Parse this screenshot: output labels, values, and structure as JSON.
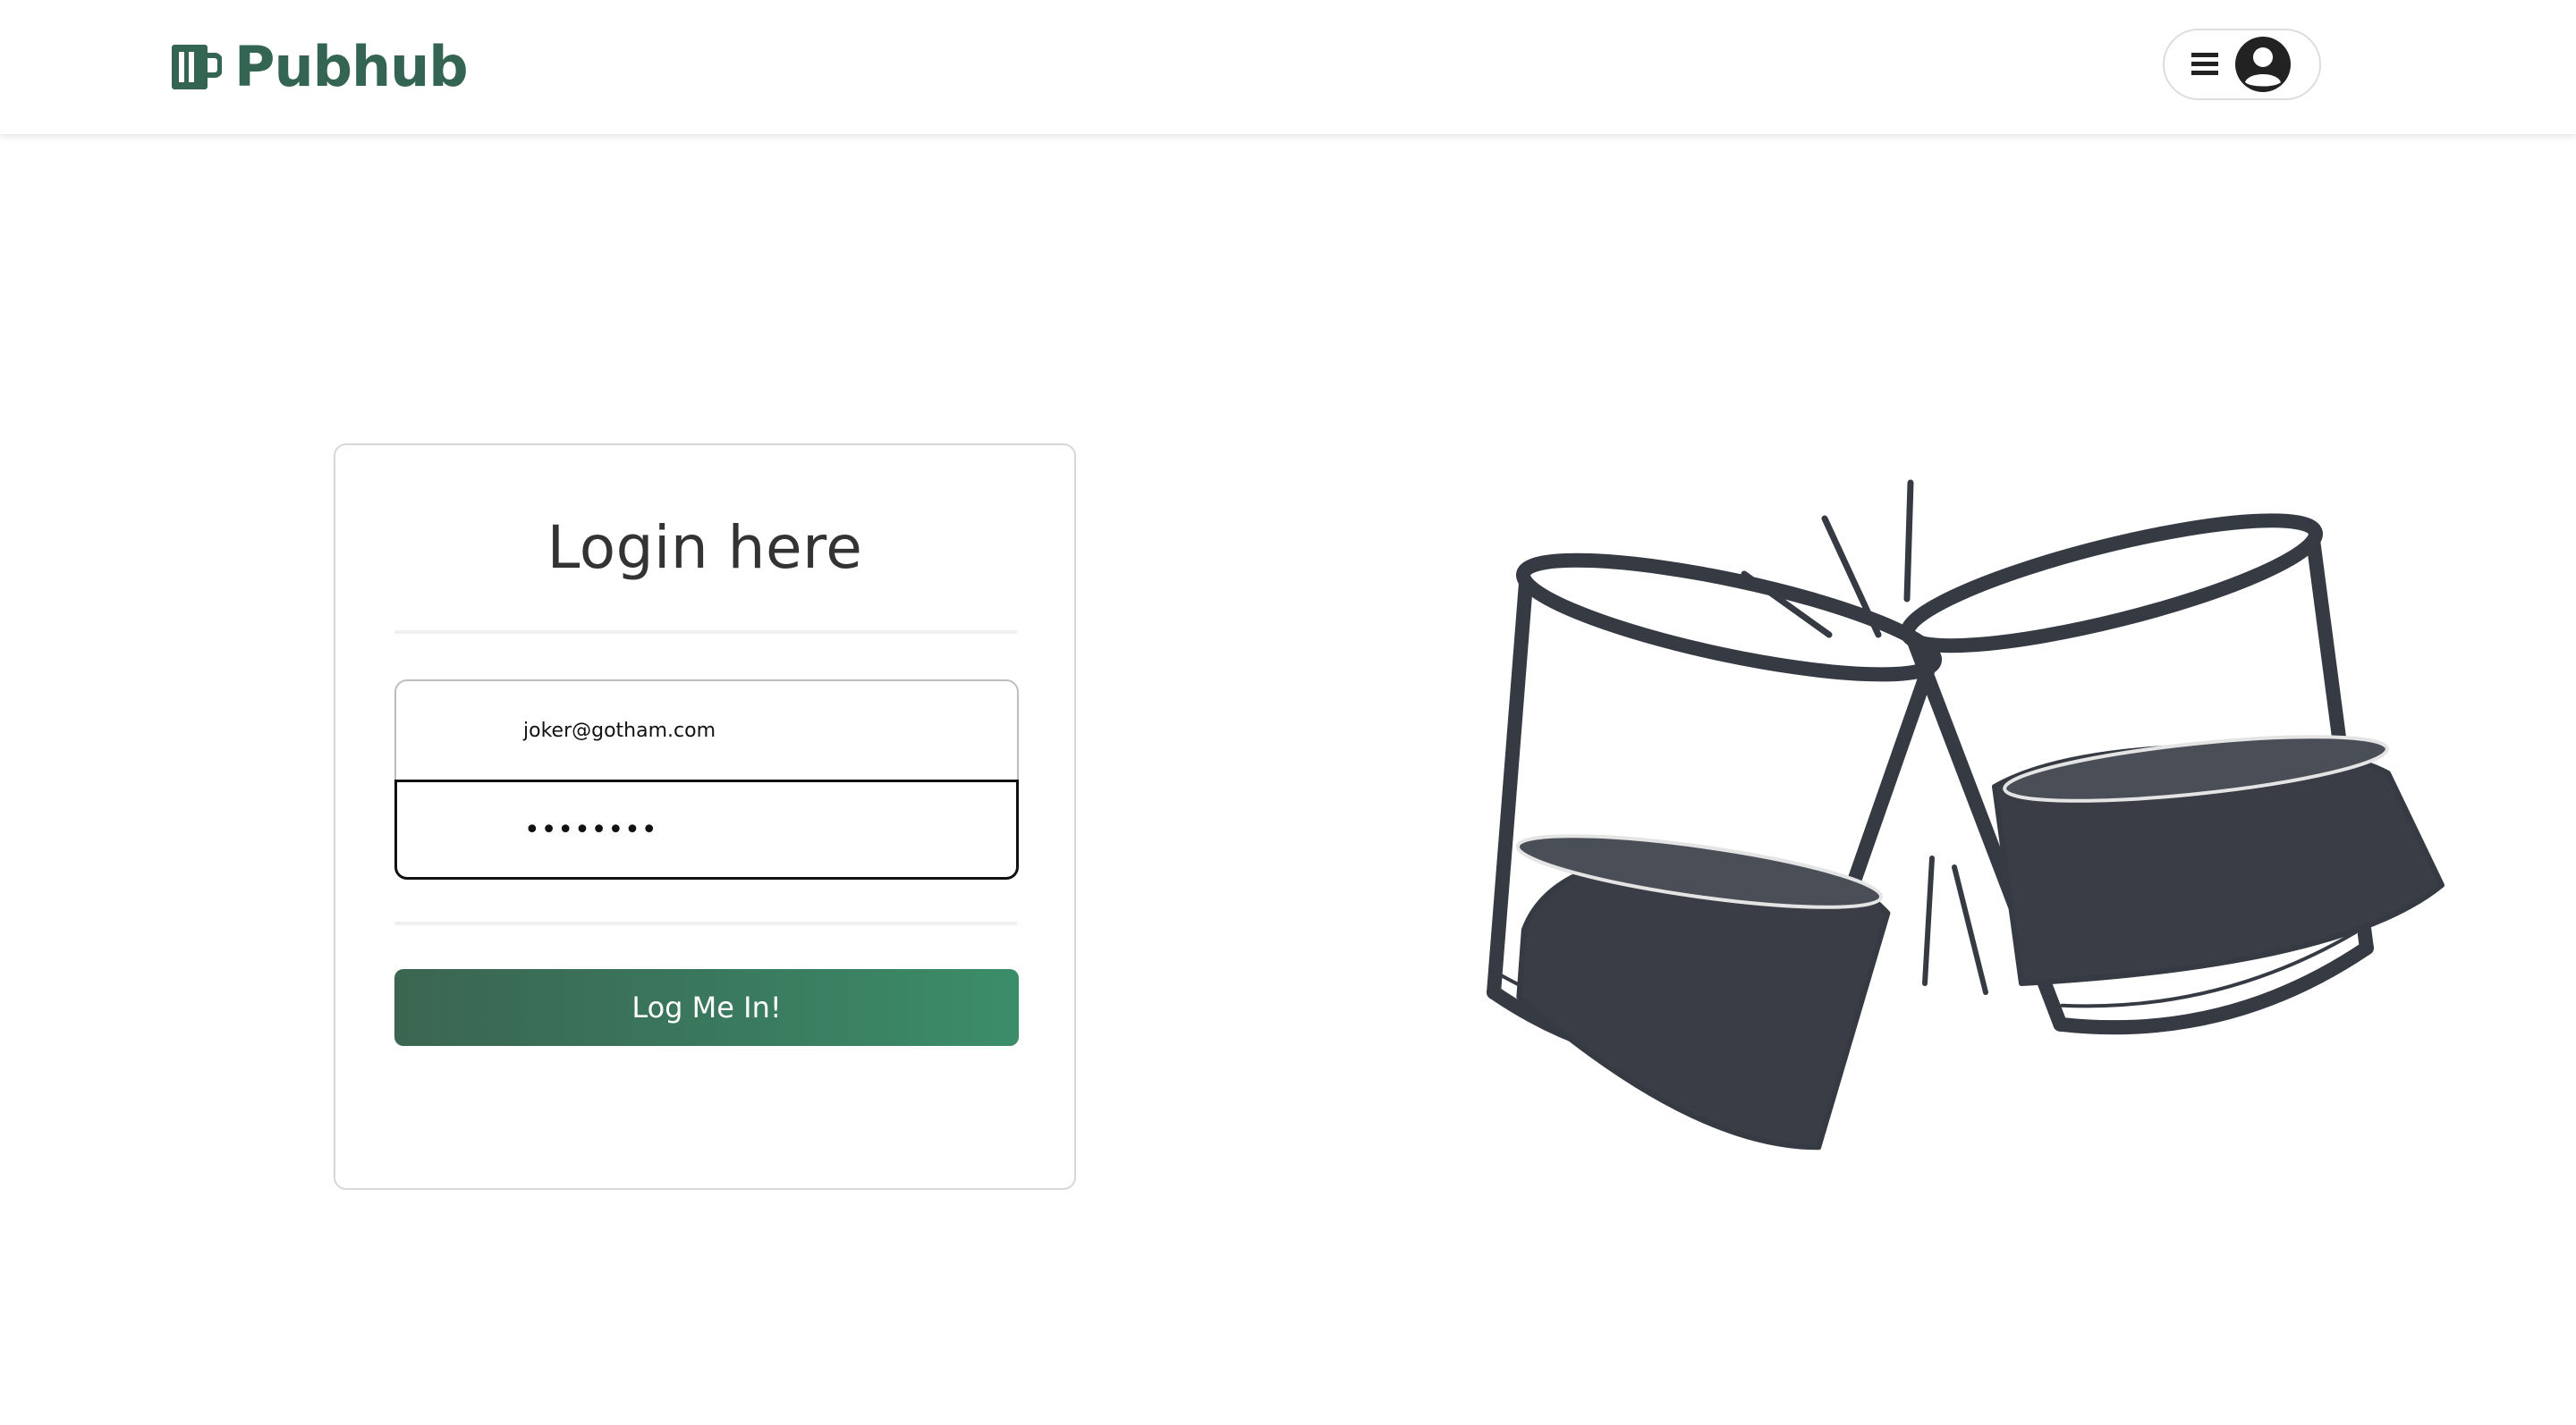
{
  "header": {
    "brand": "Pubhub",
    "brand_color": "#346553",
    "menu_icon": "hamburger-icon",
    "avatar_icon": "user-circle-icon"
  },
  "login": {
    "title": "Login here",
    "email_value": "joker@gotham.com",
    "password_value": "••••••••",
    "submit_label": "Log Me In!",
    "button_color": "#3a7a5e"
  },
  "illustration": {
    "icon": "clinking-glasses-illustration"
  }
}
